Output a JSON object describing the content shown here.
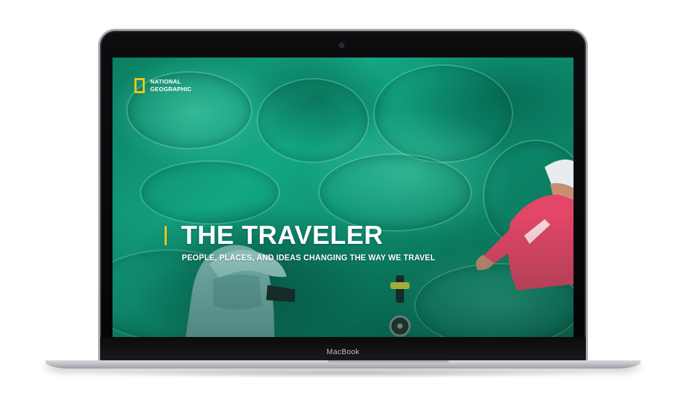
{
  "device": {
    "brand_label": "MacBook"
  },
  "site": {
    "logo_text_line1": "NATIONAL",
    "logo_text_line2": "GEOGRAPHIC",
    "accent_color": "#f2c817"
  },
  "hero": {
    "title": "THE TRAVELER",
    "subtitle": "PEOPLE, PLACES, AND IDEAS CHANGING THE WAY WE TRAVEL",
    "background_color": "#0e8f72"
  }
}
